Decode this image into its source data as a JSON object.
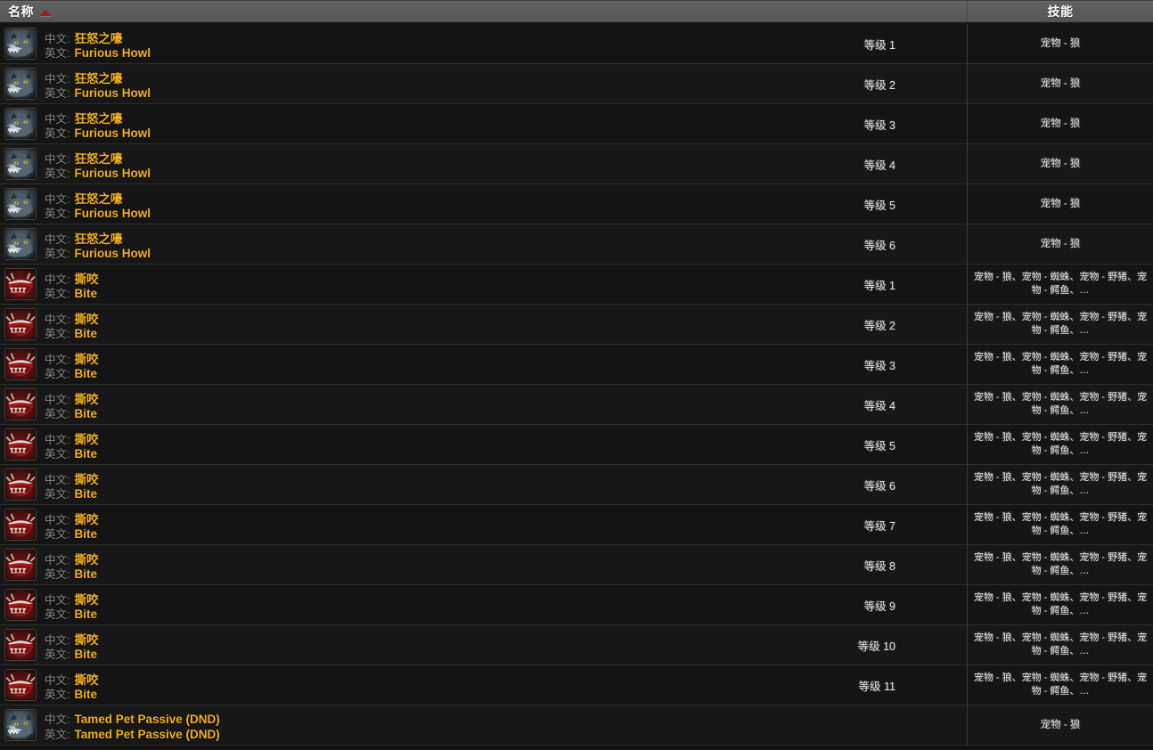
{
  "table": {
    "columns": {
      "name": "名称",
      "skill": "技能",
      "sort_indicator": "ascending-triangle"
    },
    "labels": {
      "zh": "中文:",
      "en": "英文:"
    },
    "colors": {
      "header_bg": "#5e5e5e",
      "row_bg": "#141414",
      "value_gold": "#f2b01a",
      "label_grey": "#8d8d8d",
      "sort_arrow_red": "#9b1a1a",
      "skill_text": "#e8e8e8"
    },
    "rows": [
      {
        "icon": "wolf-head-icon",
        "zh": "狂怒之嚎",
        "en": "Furious Howl",
        "rank": "等级 1",
        "skill": "宠物 - 狼"
      },
      {
        "icon": "wolf-head-icon",
        "zh": "狂怒之嚎",
        "en": "Furious Howl",
        "rank": "等级 2",
        "skill": "宠物 - 狼"
      },
      {
        "icon": "wolf-head-icon",
        "zh": "狂怒之嚎",
        "en": "Furious Howl",
        "rank": "等级 3",
        "skill": "宠物 - 狼"
      },
      {
        "icon": "wolf-head-icon",
        "zh": "狂怒之嚎",
        "en": "Furious Howl",
        "rank": "等级 4",
        "skill": "宠物 - 狼"
      },
      {
        "icon": "wolf-head-icon",
        "zh": "狂怒之嚎",
        "en": "Furious Howl",
        "rank": "等级 5",
        "skill": "宠物 - 狼"
      },
      {
        "icon": "wolf-head-icon",
        "zh": "狂怒之嚎",
        "en": "Furious Howl",
        "rank": "等级 6",
        "skill": "宠物 - 狼"
      },
      {
        "icon": "biting-maw-icon",
        "zh": "撕咬",
        "en": "Bite",
        "rank": "等级 1",
        "skill": "宠物 - 狼、宠物 - 蜘蛛、宠物 - 野猪、宠物 - 鳄鱼、…"
      },
      {
        "icon": "biting-maw-icon",
        "zh": "撕咬",
        "en": "Bite",
        "rank": "等级 2",
        "skill": "宠物 - 狼、宠物 - 蜘蛛、宠物 - 野猪、宠物 - 鳄鱼、…"
      },
      {
        "icon": "biting-maw-icon",
        "zh": "撕咬",
        "en": "Bite",
        "rank": "等级 3",
        "skill": "宠物 - 狼、宠物 - 蜘蛛、宠物 - 野猪、宠物 - 鳄鱼、…"
      },
      {
        "icon": "biting-maw-icon",
        "zh": "撕咬",
        "en": "Bite",
        "rank": "等级 4",
        "skill": "宠物 - 狼、宠物 - 蜘蛛、宠物 - 野猪、宠物 - 鳄鱼、…"
      },
      {
        "icon": "biting-maw-icon",
        "zh": "撕咬",
        "en": "Bite",
        "rank": "等级 5",
        "skill": "宠物 - 狼、宠物 - 蜘蛛、宠物 - 野猪、宠物 - 鳄鱼、…"
      },
      {
        "icon": "biting-maw-icon",
        "zh": "撕咬",
        "en": "Bite",
        "rank": "等级 6",
        "skill": "宠物 - 狼、宠物 - 蜘蛛、宠物 - 野猪、宠物 - 鳄鱼、…"
      },
      {
        "icon": "biting-maw-icon",
        "zh": "撕咬",
        "en": "Bite",
        "rank": "等级 7",
        "skill": "宠物 - 狼、宠物 - 蜘蛛、宠物 - 野猪、宠物 - 鳄鱼、…"
      },
      {
        "icon": "biting-maw-icon",
        "zh": "撕咬",
        "en": "Bite",
        "rank": "等级 8",
        "skill": "宠物 - 狼、宠物 - 蜘蛛、宠物 - 野猪、宠物 - 鳄鱼、…"
      },
      {
        "icon": "biting-maw-icon",
        "zh": "撕咬",
        "en": "Bite",
        "rank": "等级 9",
        "skill": "宠物 - 狼、宠物 - 蜘蛛、宠物 - 野猪、宠物 - 鳄鱼、…"
      },
      {
        "icon": "biting-maw-icon",
        "zh": "撕咬",
        "en": "Bite",
        "rank": "等级 10",
        "skill": "宠物 - 狼、宠物 - 蜘蛛、宠物 - 野猪、宠物 - 鳄鱼、…"
      },
      {
        "icon": "biting-maw-icon",
        "zh": "撕咬",
        "en": "Bite",
        "rank": "等级 11",
        "skill": "宠物 - 狼、宠物 - 蜘蛛、宠物 - 野猪、宠物 - 鳄鱼、…"
      },
      {
        "icon": "wolf-head-icon",
        "zh": "Tamed Pet Passive (DND)",
        "en": "Tamed Pet Passive (DND)",
        "rank": "",
        "skill": "宠物 - 狼"
      }
    ]
  }
}
